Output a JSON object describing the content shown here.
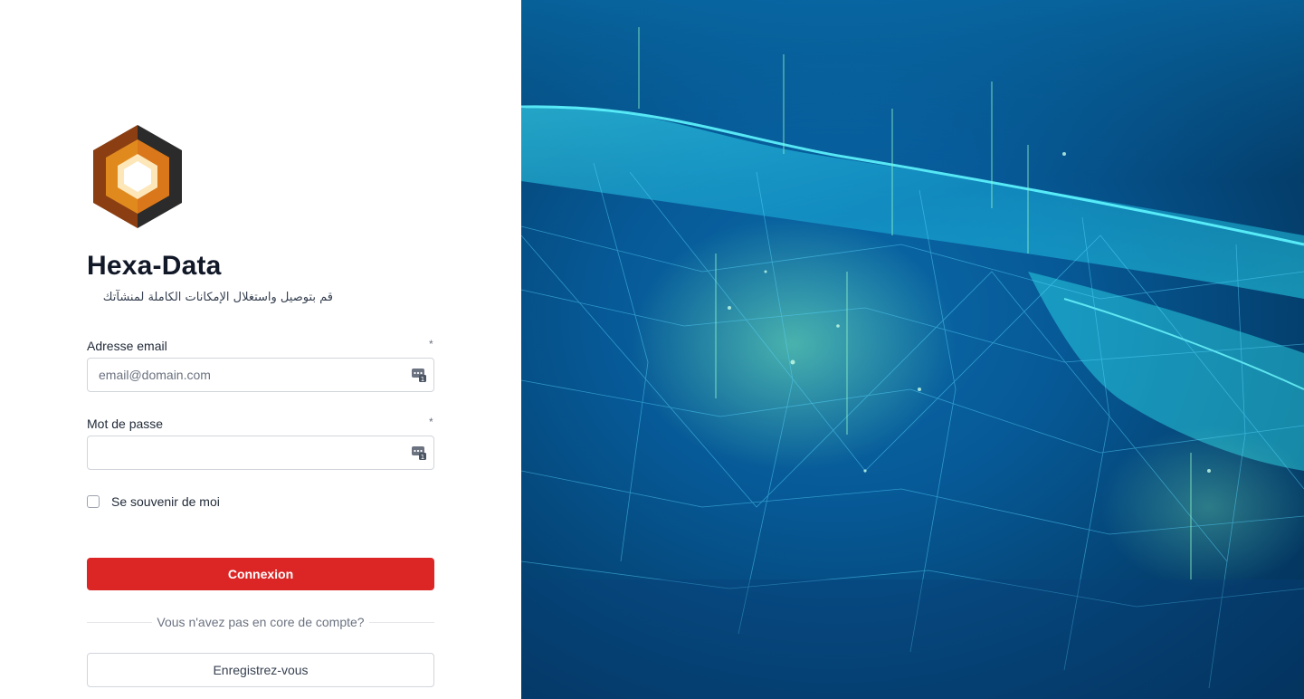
{
  "brand": {
    "name": "Hexa-Data",
    "tagline": "قم بتوصيل واستغلال الإمكانات الكاملة لمنشآتك"
  },
  "form": {
    "email": {
      "label": "Adresse email",
      "required_mark": "*",
      "placeholder": "email@domain.com",
      "value": ""
    },
    "password": {
      "label": "Mot de passe",
      "required_mark": "*",
      "placeholder": "",
      "value": ""
    },
    "remember_me": {
      "label": "Se souvenir de moi",
      "checked": false
    },
    "submit_label": "Connexion"
  },
  "signup": {
    "prompt": "Vous n'avez pas en core de compte?",
    "button_label": "Enregistrez-vous"
  },
  "colors": {
    "primary_button": "#dc2626",
    "logo_dark": "#2b2b2b",
    "logo_brown": "#8b3e12",
    "logo_orange": "#e08a1e",
    "logo_cream": "#f7f1df",
    "background_blue": "#065996",
    "mesh_cyan": "#2fe6f5"
  },
  "icons": {
    "field_icon": "password-manager-key-icon",
    "logo": "hexagon-logo"
  }
}
